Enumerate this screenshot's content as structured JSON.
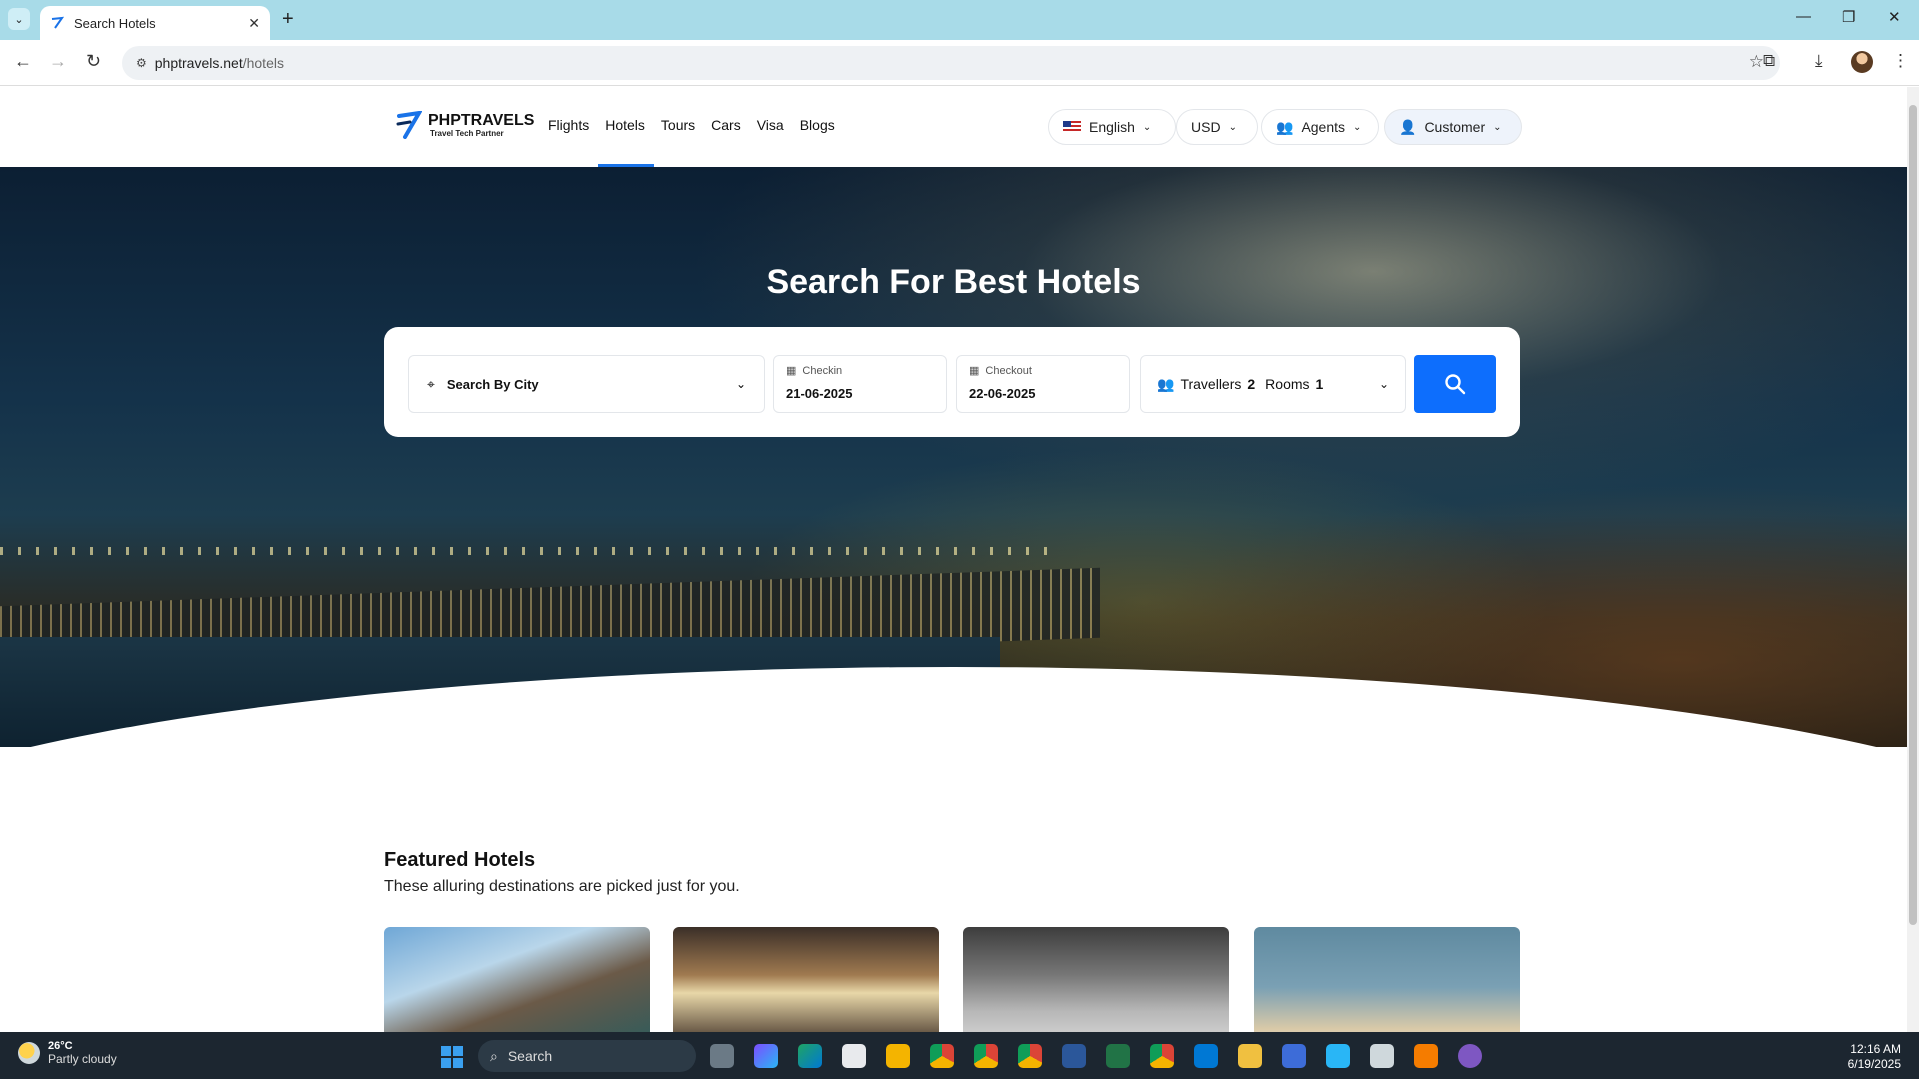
{
  "browser": {
    "tab_title": "Search Hotels",
    "url_host": "phptravels.net",
    "url_path": "/hotels"
  },
  "site": {
    "brand": "PHPTRAVELS",
    "tagline": "Travel Tech Partner",
    "nav": [
      "Flights",
      "Hotels",
      "Tours",
      "Cars",
      "Visa",
      "Blogs"
    ],
    "active_nav": "Hotels",
    "language": "English",
    "currency": "USD",
    "agents": "Agents",
    "customer": "Customer"
  },
  "hero": {
    "heading": "Search For Best Hotels"
  },
  "search": {
    "city_placeholder": "Search By City",
    "checkin_label": "Checkin",
    "checkin_value": "21-06-2025",
    "checkout_label": "Checkout",
    "checkout_value": "22-06-2025",
    "travellers_label": "Travellers",
    "travellers_value": "2",
    "rooms_label": "Rooms",
    "rooms_value": "1"
  },
  "featured": {
    "title": "Featured Hotels",
    "subtitle": "These alluring destinations are picked just for you."
  },
  "taskbar": {
    "temp": "26°C",
    "weather": "Partly cloudy",
    "search": "Search",
    "time": "12:16 AM",
    "date": "6/19/2025"
  },
  "colors": {
    "accent": "#0d6efd",
    "taskbar": "#1c2630",
    "tabstrip": "#a8dbe8"
  }
}
